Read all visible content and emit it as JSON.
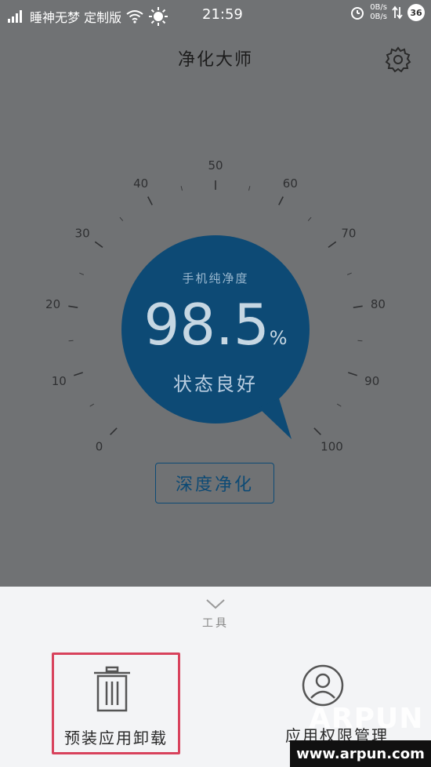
{
  "status_bar": {
    "carrier": "睡神无梦 定制版",
    "time": "21:59",
    "net_up": "0B/s",
    "net_down": "0B/s",
    "battery": "36",
    "signal_icon": "signal-icon",
    "wifi_icon": "wifi-icon",
    "sun_icon": "sun-icon",
    "alarm_icon": "alarm-icon"
  },
  "header": {
    "title": "净化大师",
    "settings_icon": "gear-icon"
  },
  "gauge": {
    "ticks": [
      "0",
      "10",
      "20",
      "30",
      "40",
      "50",
      "60",
      "70",
      "80",
      "90",
      "100"
    ],
    "label": "手机纯净度",
    "value": "98.5",
    "unit": "%",
    "status": "状态良好",
    "level_percent": 98.5,
    "color": "#0d4a75"
  },
  "deep_clean": {
    "label": "深度净化"
  },
  "tools": {
    "label": "工具",
    "items": [
      {
        "label": "预装应用卸载",
        "icon": "trash-icon"
      },
      {
        "label": "应用权限管理",
        "icon": "user-icon"
      }
    ],
    "highlight_color": "#d8425c"
  },
  "watermark": {
    "brand": "ARPUN",
    "url": "www.arpun.com"
  }
}
